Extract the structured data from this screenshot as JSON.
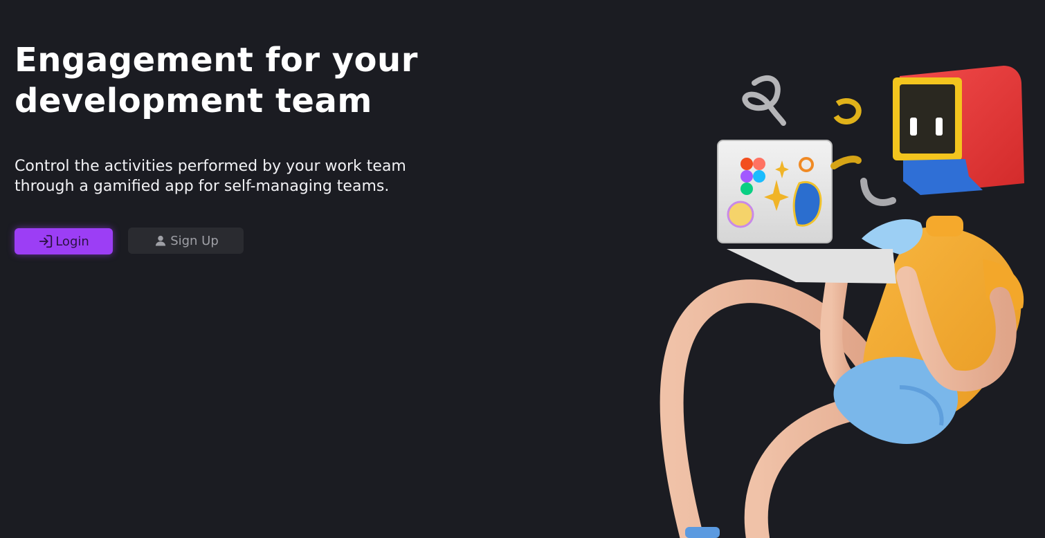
{
  "hero": {
    "title": "Engagement for your development team",
    "subtitle": "Control the activities performed by your work team through a gamified app for self-managing teams."
  },
  "actions": {
    "login_label": "Login",
    "login_icon": "login-icon",
    "signup_label": "Sign Up",
    "signup_icon": "user-icon"
  },
  "colors": {
    "background": "#1b1c22",
    "primary": "#9c3ef5",
    "secondary_button": "#2a2b30"
  }
}
